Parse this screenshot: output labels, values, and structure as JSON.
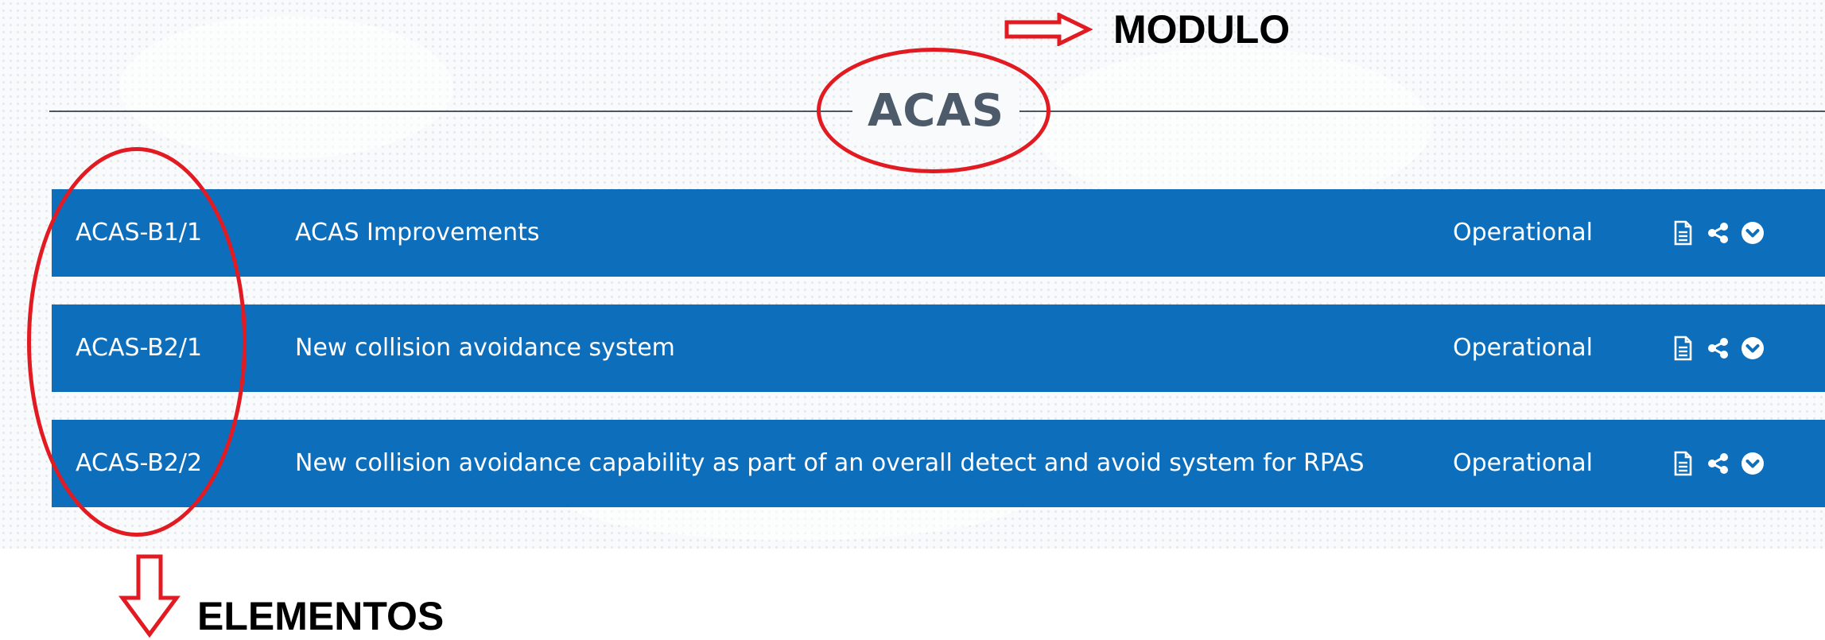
{
  "module": {
    "title": "ACAS"
  },
  "elements": [
    {
      "code": "ACAS-B1/1",
      "name": "ACAS Improvements",
      "status": "Operational"
    },
    {
      "code": "ACAS-B2/1",
      "name": "New collision avoidance system",
      "status": "Operational"
    },
    {
      "code": "ACAS-B2/2",
      "name": "New collision avoidance capability as part of an overall detect and avoid system for RPAS",
      "status": "Operational"
    }
  ],
  "icons": [
    "document-icon",
    "share-icon",
    "chevron-down-circle-icon"
  ],
  "annotations": {
    "module_label": "MODULO",
    "elements_label": "ELEMENTOS"
  },
  "colors": {
    "row_bg": "#0d6ebc",
    "annotation": "#e21b22",
    "title": "#4d5a69"
  }
}
